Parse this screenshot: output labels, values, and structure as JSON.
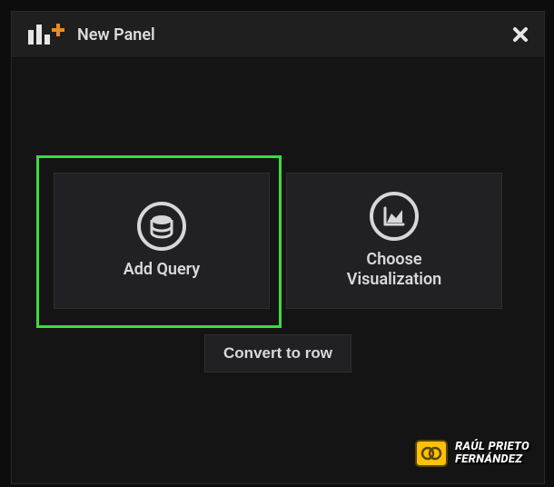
{
  "header": {
    "title": "New Panel"
  },
  "cards": {
    "add_query": "Add Query",
    "choose_viz": "Choose\nVisualization"
  },
  "actions": {
    "convert_to_row": "Convert to row"
  },
  "watermark": {
    "text": "RAÚL PRIETO\nFERNÁNDEZ"
  },
  "colors": {
    "highlight": "#3cdb3c",
    "accent": "#ec8b2a"
  }
}
